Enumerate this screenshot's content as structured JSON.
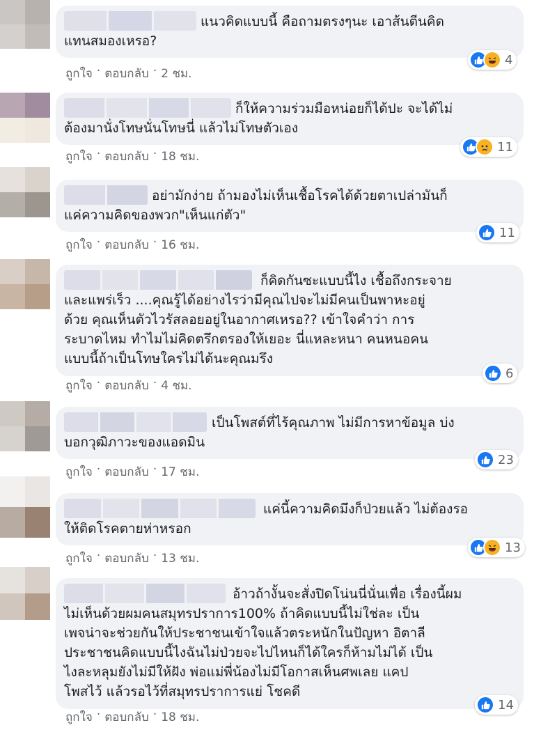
{
  "actions": {
    "like": "ถูกใจ",
    "reply": "ตอบกลับ",
    "separator": "·"
  },
  "comments": [
    {
      "text": "แนวคิดแบบนี้ คือถามตรงๆนะ เอาส้นตีนคิด\nแทนสมองเหรอ?",
      "time": "2 ชม.",
      "reactions": [
        "like-icon",
        "haha-icon"
      ],
      "reaction_count": "4"
    },
    {
      "text": "ก็ให้ความร่วมมือหน่อยก็ได้ปะ จะได้ไม่\nต้องมานั่งโทษนั่นโทษนี่ แล้วไม่โทษตัวเอง",
      "time": "18 ชม.",
      "reactions": [
        "like-icon",
        "sad-icon"
      ],
      "reaction_count": "11"
    },
    {
      "text": "อย่ามักง่าย ถ้ามองไม่เห็นเชื้อโรคได้ด้วยตาเปล่ามันก็\nแค่ความคิดของพวก\"เห็นแก่ตัว\"",
      "time": "16 ชม.",
      "reactions": [
        "like-icon"
      ],
      "reaction_count": "11"
    },
    {
      "text": "ก็คิดกันซะแบบนี้ไง เชื้อถึงกระจาย\nและแพร่เร็ว ....คุณรู้ได้อย่างไรว่ามีคุณไปจะไม่มีคนเป็นพาหะอยู่\nด้วย คุณเห็นตัวไวรัสลอยอยู่ในอากาศเหรอ?? เข้าใจคำว่า การ\nระบาดไหม ทำไมไม่คิดตรึกตรองให้เยอะ นี่แหละหนา คนหนอคน\nแบบนี้ถ้าเป็นโทษใครไม่ได้นะคุณมรึง",
      "time": "4 ชม.",
      "reactions": [
        "like-icon"
      ],
      "reaction_count": "6"
    },
    {
      "text": "เป็นโพสต์ที่ไร้คุณภาพ ไม่มีการหาข้อมูล บ่ง\nบอกวุฒิภาวะของแอดมิน",
      "time": "17 ชม.",
      "reactions": [
        "like-icon"
      ],
      "reaction_count": "23"
    },
    {
      "text": "แค่นี้ความคิดมึงก็ป่วยแล้ว ไม่ต้องรอ\nให้ติดโรคตายห่าหรอก",
      "time": "13 ชม.",
      "reactions": [
        "like-icon",
        "haha-icon"
      ],
      "reaction_count": "13"
    },
    {
      "text": "อ้าวถ้างั้นจะสั่งปิดโน่นนี่นั่นเพื่อ เรื่องนี้ผม\nไม่เห็นด้วยผมคนสมุทรปราการ100% ถ้าคิดแบบนี้ไม่ใช่ละ เป็น\nเพจน่าจะช่วยกันให้ประชาชนเข้าใจแล้วตระหนักในปัญหา อิตาลี\nประชาชนคิดแบบนี้ไงฉันไม่ป่วยจะไปไหนก็ได้ใครก็ห้ามไม่ได้ เป็น\nไงละหลุมยังไม่มีให้ฝัง พ่อแม่พี่น้องไม่มีโอกาสเห็นศพเลย แคป\nโพสไว้ แล้วรอไว้ที่สมุทรปราการแย่ โชคดี",
      "time": "18 ชม.",
      "reactions": [
        "like-icon"
      ],
      "reaction_count": "14"
    }
  ]
}
